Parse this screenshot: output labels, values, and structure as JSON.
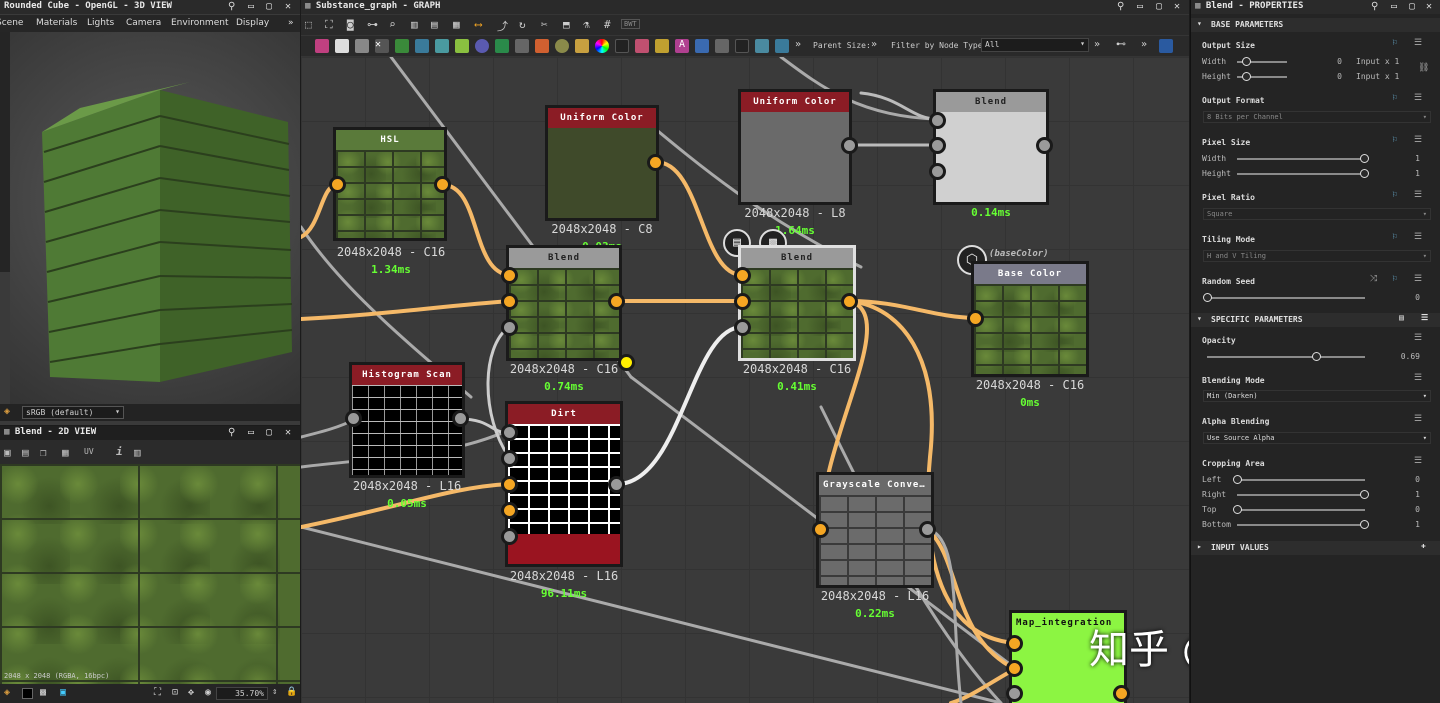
{
  "view3d": {
    "title": "Rounded Cube - OpenGL - 3D VIEW",
    "menu": [
      "Scene",
      "Materials",
      "Lights",
      "Camera",
      "Environment",
      "Display"
    ],
    "colorspace": "sRGB (default)"
  },
  "view2d": {
    "title": "Blend - 2D VIEW",
    "uv_label": "UV",
    "status": "2048 x 2048 (RGBA, 16bpc)",
    "zoom": "35.70%"
  },
  "graph": {
    "title": "Substance_graph - GRAPH",
    "toolbar_bwt": "BWT",
    "parent_size_label": "Parent Size:",
    "filter_label": "Filter by Node Type",
    "filter_value": "All",
    "nodes": {
      "hsl": {
        "title": "HSL",
        "res": "2048x2048 - C16",
        "time": "1.34ms"
      },
      "uniform1": {
        "title": "Uniform Color",
        "res": "2048x2048 - C8",
        "time": "0.03ms"
      },
      "uniform2": {
        "title": "Uniform Color",
        "res": "2048x2048 - L8",
        "time": "1.64ms"
      },
      "blend_top": {
        "title": "Blend",
        "time": "0.14ms"
      },
      "blend1": {
        "title": "Blend",
        "res": "2048x2048 - C16",
        "time": "0.74ms"
      },
      "blend2": {
        "title": "Blend",
        "res": "2048x2048 - C16",
        "time": "0.41ms"
      },
      "basecolor": {
        "title": "Base Color",
        "tag": "(baseColor)",
        "res": "2048x2048 - C16",
        "time": "0ms"
      },
      "histogram": {
        "title": "Histogram Scan",
        "res": "2048x2048 - L16",
        "time": "0.05ms"
      },
      "dirt": {
        "title": "Dirt",
        "res": "2048x2048 - L16",
        "time": "96.11ms"
      },
      "grayscale": {
        "title": "Grayscale Conve…",
        "res": "2048x2048 - L16",
        "time": "0.22ms"
      },
      "mapint": {
        "title": "Map_integration"
      }
    },
    "watermark": "知乎 @夜雨寒城"
  },
  "properties": {
    "title": "Blend - PROPERTIES",
    "sections": {
      "base": "BASE PARAMETERS",
      "specific": "SPECIFIC PARAMETERS",
      "input": "INPUT VALUES"
    },
    "output_size": {
      "label": "Output Size",
      "width_label": "Width",
      "height_label": "Height",
      "width_val": "0",
      "height_val": "0",
      "width_rel": "Input x 1",
      "height_rel": "Input x 1",
      "width_frac": 0.18,
      "height_frac": 0.18
    },
    "output_format": {
      "label": "Output Format",
      "value": "8 Bits per Channel"
    },
    "pixel_size": {
      "label": "Pixel Size",
      "width_label": "Width",
      "height_label": "Height",
      "width_val": "1",
      "height_val": "1"
    },
    "pixel_ratio": {
      "label": "Pixel Ratio",
      "value": "Square"
    },
    "tiling_mode": {
      "label": "Tiling Mode",
      "value": "H and V Tiling"
    },
    "random_seed": {
      "label": "Random Seed",
      "value": "0"
    },
    "opacity": {
      "label": "Opacity",
      "value": "0.69",
      "frac": 0.69
    },
    "blending_mode": {
      "label": "Blending Mode",
      "value": "Min (Darken)"
    },
    "alpha_blending": {
      "label": "Alpha Blending",
      "value": "Use Source Alpha"
    },
    "cropping": {
      "label": "Cropping Area",
      "left_label": "Left",
      "right_label": "Right",
      "top_label": "Top",
      "bottom_label": "Bottom",
      "left": "0",
      "right": "1",
      "top": "0",
      "bottom": "1"
    }
  },
  "colors": {
    "orange": "#f5a623",
    "green_time": "#66ff33",
    "red_header": "#8b1c25",
    "gray_header": "#9a9a9a",
    "map_green": "#8cf542"
  }
}
